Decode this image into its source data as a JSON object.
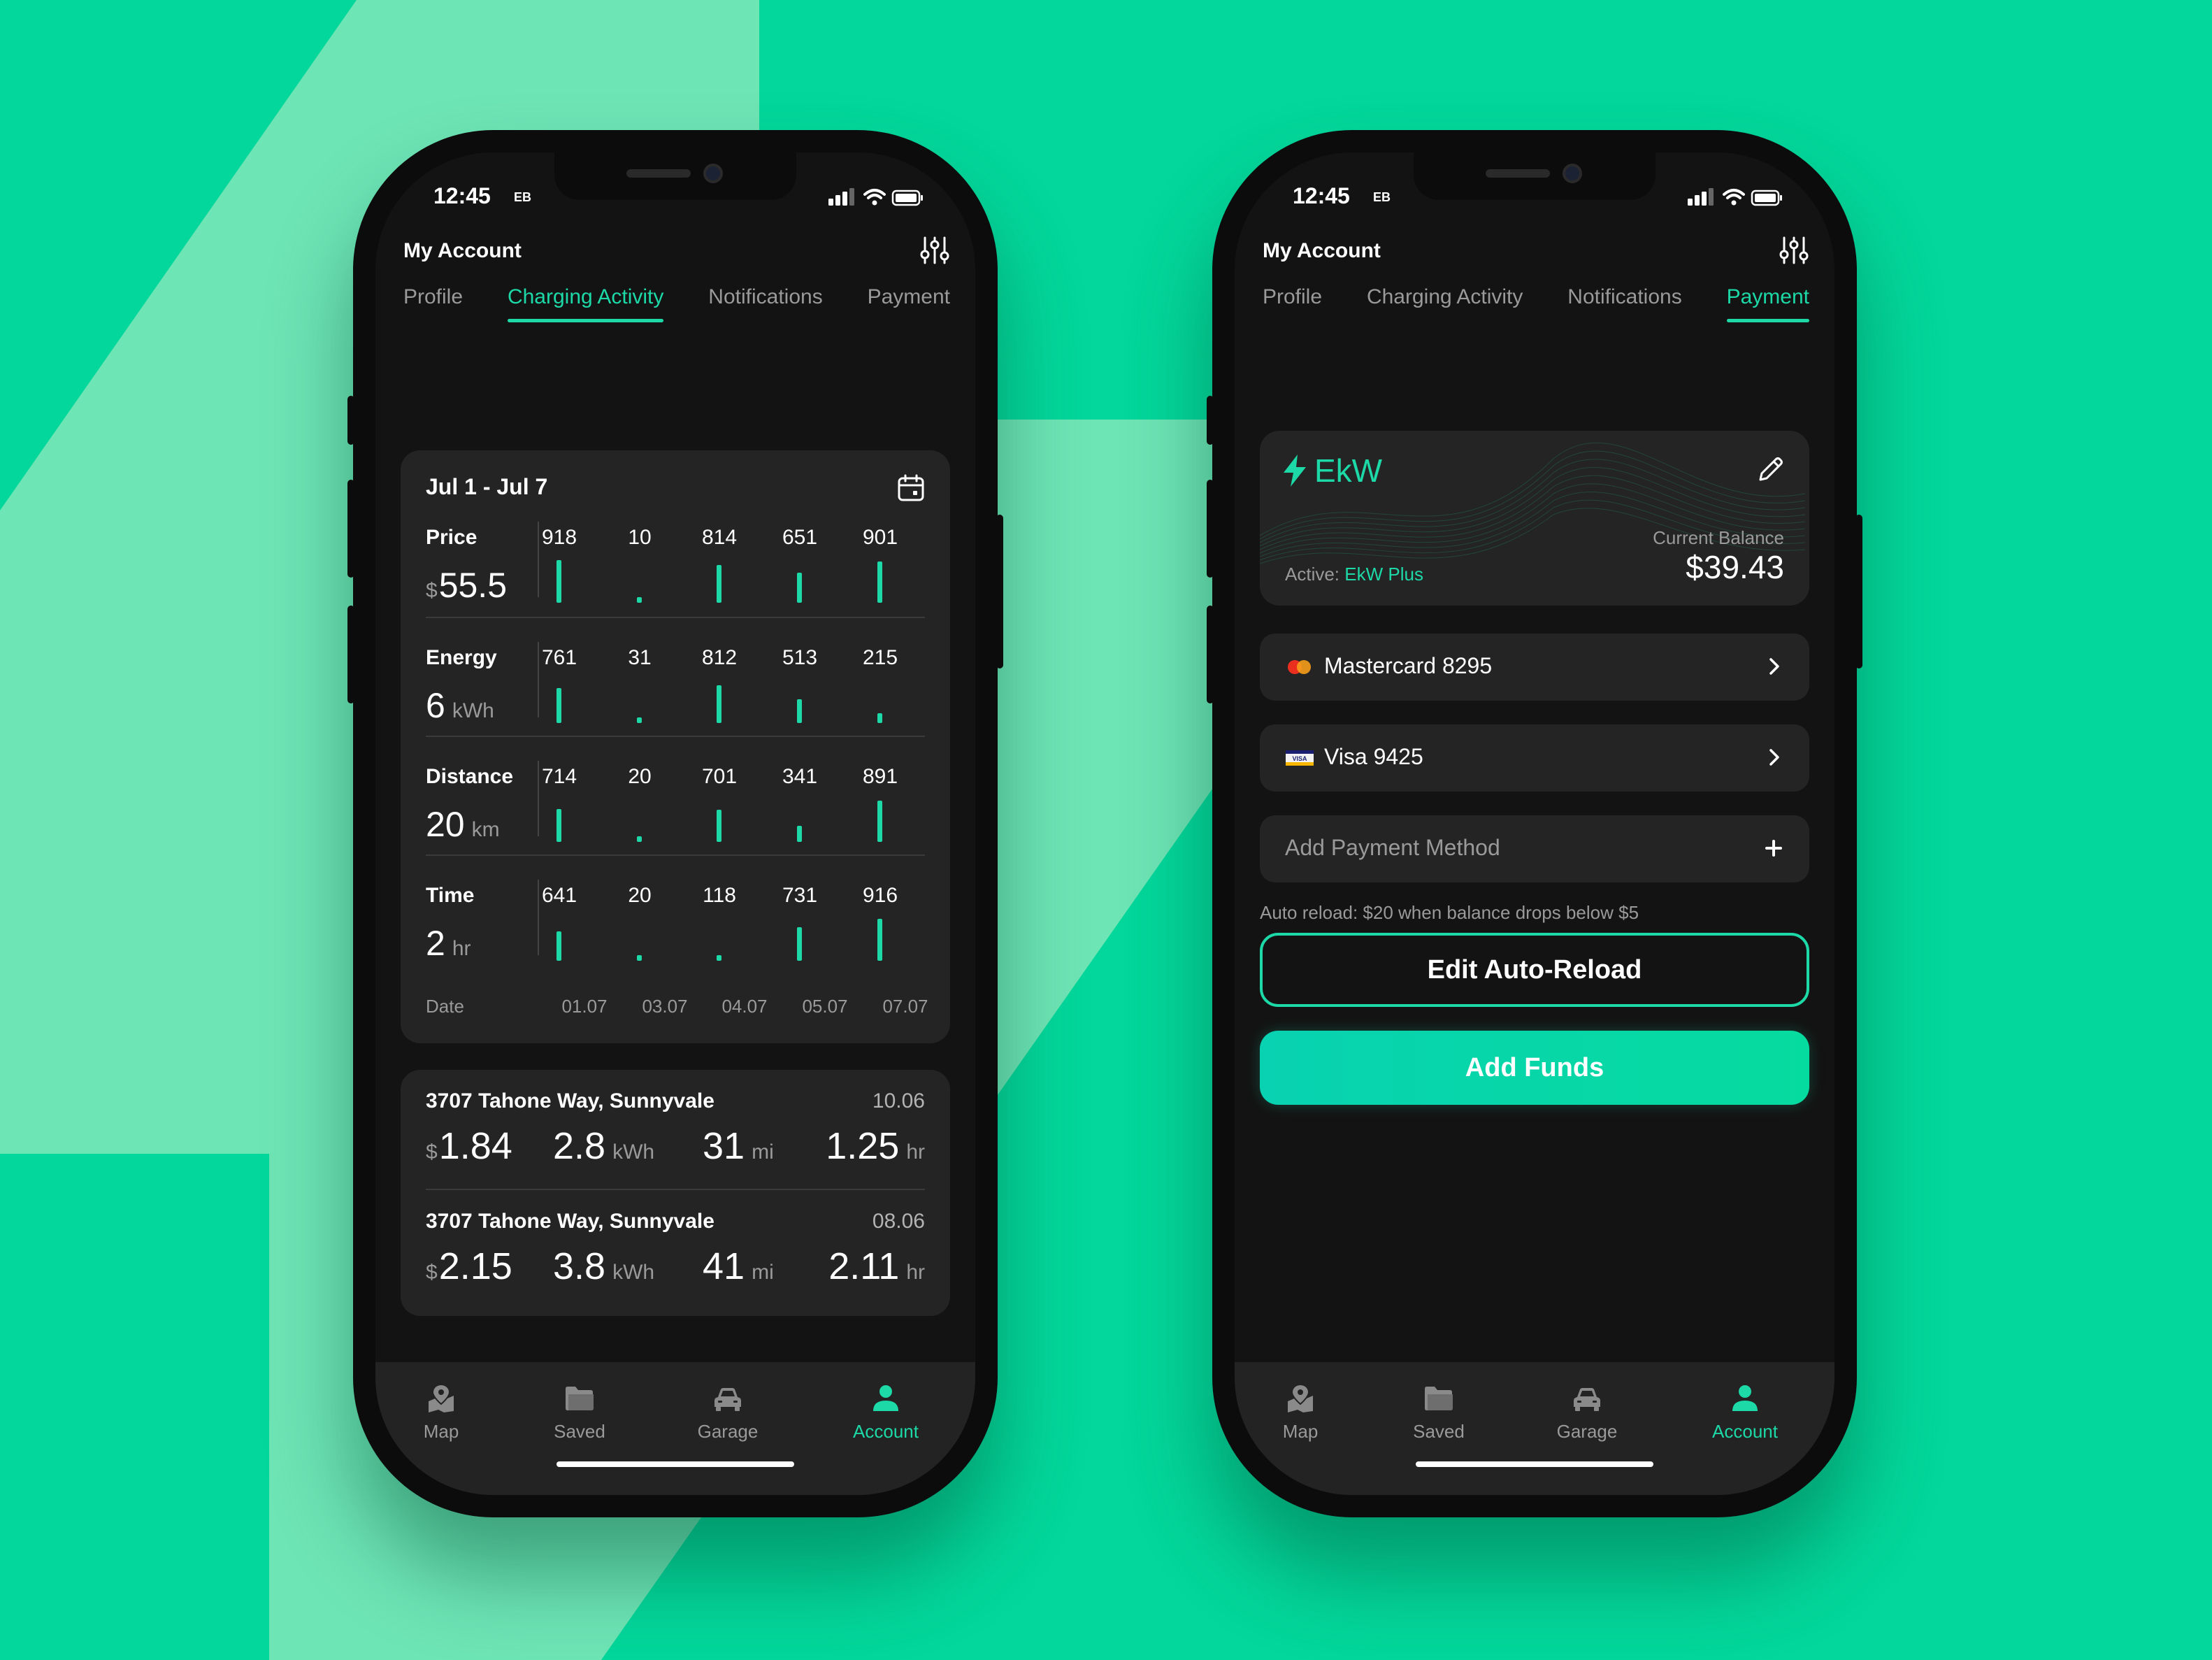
{
  "colors": {
    "background": "#03d79b",
    "accent": "#1cd9a7",
    "screen": "#131313",
    "card": "#242424"
  },
  "status": {
    "time": "12:45",
    "carrier": "EB"
  },
  "header": {
    "title": "My Account"
  },
  "tabs": [
    "Profile",
    "Charging Activity",
    "Notifications",
    "Payment"
  ],
  "activity": {
    "range": "Jul 1 - Jul 7",
    "date_label": "Date",
    "dates": [
      "01.07",
      "03.07",
      "04.07",
      "05.07",
      "07.07"
    ],
    "metrics": [
      {
        "name": "Price",
        "currency": "$",
        "value": "55.5",
        "unit": "",
        "values": [
          918,
          10,
          814,
          651,
          901
        ]
      },
      {
        "name": "Energy",
        "currency": "",
        "value": "6",
        "unit": "kWh",
        "values": [
          761,
          31,
          812,
          513,
          215
        ]
      },
      {
        "name": "Distance",
        "currency": "",
        "value": "20",
        "unit": "km",
        "values": [
          714,
          20,
          701,
          341,
          891
        ]
      },
      {
        "name": "Time",
        "currency": "",
        "value": "2",
        "unit": "hr",
        "values": [
          641,
          20,
          118,
          731,
          916
        ]
      }
    ]
  },
  "sessions": [
    {
      "address": "3707 Tahone Way, Sunnyvale",
      "date": "10.06",
      "currency": "$",
      "price": "1.84",
      "energy": "2.8",
      "energy_unit": "kWh",
      "distance": "31",
      "distance_unit": "mi",
      "time": "1.25",
      "time_unit": "hr"
    },
    {
      "address": "3707 Tahone Way, Sunnyvale",
      "date": "08.06",
      "currency": "$",
      "price": "2.15",
      "energy": "3.8",
      "energy_unit": "kWh",
      "distance": "41",
      "distance_unit": "mi",
      "time": "2.11",
      "time_unit": "hr"
    }
  ],
  "payment": {
    "brand": "EkW",
    "active_label": "Active:",
    "plan": "EkW Plus",
    "balance_label": "Current Balance",
    "balance": "$39.43",
    "methods": [
      {
        "label": "Mastercard 8295",
        "icon": "mastercard-icon"
      },
      {
        "label": "Visa 9425",
        "icon": "visa-icon"
      }
    ],
    "add_method": "Add Payment Method",
    "auto_reload_note": "Auto reload: $20 when balance drops below $5",
    "edit_auto_reload": "Edit Auto-Reload",
    "add_funds": "Add Funds"
  },
  "nav": [
    {
      "label": "Map",
      "icon": "map-pin-icon"
    },
    {
      "label": "Saved",
      "icon": "folder-icon"
    },
    {
      "label": "Garage",
      "icon": "car-icon"
    },
    {
      "label": "Account",
      "icon": "user-icon"
    }
  ],
  "nav_active": "Account"
}
